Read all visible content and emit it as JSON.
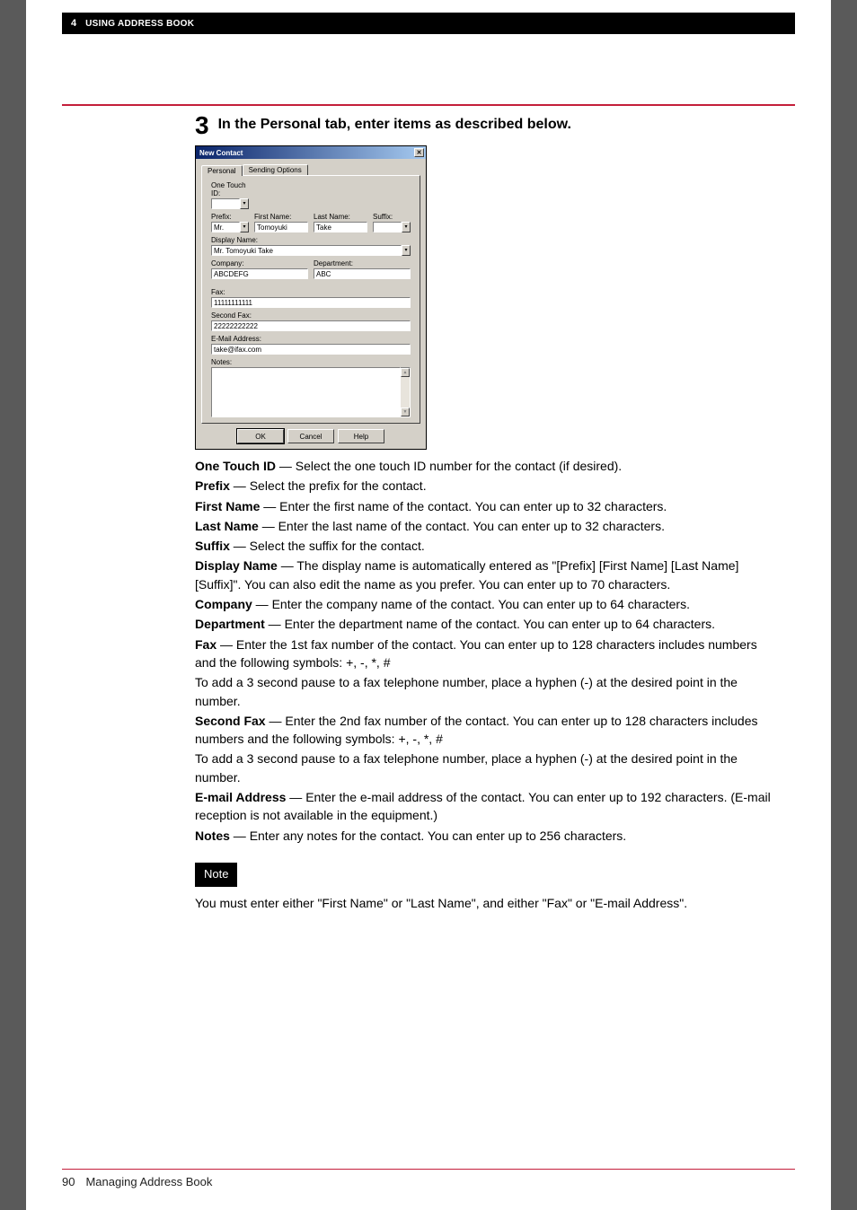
{
  "header": {
    "chapter_num": "4",
    "chapter_title": "USING ADDRESS BOOK"
  },
  "step": {
    "number": "3",
    "heading": "In the Personal tab, enter items as described below."
  },
  "dialog": {
    "title": "New Contact",
    "tabs": {
      "active": "Personal",
      "inactive": "Sending Options"
    },
    "labels": {
      "one_touch": "One Touch ID:",
      "prefix": "Prefix:",
      "first_name": "First Name:",
      "last_name": "Last Name:",
      "suffix": "Suffix:",
      "display_name": "Display Name:",
      "company": "Company:",
      "department": "Department:",
      "fax": "Fax:",
      "second_fax": "Second Fax:",
      "email": "E-Mail Address:",
      "notes": "Notes:"
    },
    "values": {
      "one_touch": "",
      "prefix": "Mr.",
      "first_name": "Tomoyuki",
      "last_name": "Take",
      "suffix": "",
      "display_name": "Mr. Tomoyuki Take",
      "company": "ABCDEFG",
      "department": "ABC",
      "fax": "11111111111",
      "second_fax": "22222222222",
      "email": "take@ifax.com",
      "notes": ""
    },
    "buttons": {
      "ok": "OK",
      "cancel": "Cancel",
      "help": "Help"
    }
  },
  "definitions": {
    "one_touch_id": {
      "term": "One Touch ID",
      "sep": " — ",
      "desc": "Select the one touch ID number for the contact (if desired)."
    },
    "prefix": {
      "term": "Prefix",
      "sep": " — ",
      "desc": "Select the prefix for the contact."
    },
    "first_name": {
      "term": "First Name",
      "sep": " — ",
      "desc": "Enter the first name of the contact. You can enter up to 32 characters."
    },
    "last_name": {
      "term": "Last Name",
      "sep": " — ",
      "desc": "Enter the last name of the contact. You can enter up to 32 characters."
    },
    "suffix": {
      "term": "Suffix",
      "sep": " — ",
      "desc": "Select the suffix for the contact."
    },
    "display_name": {
      "term": "Display Name",
      "sep": " — ",
      "desc": "The display name is automatically entered as \"[Prefix] [First Name] [Last Name] [Suffix]\". You can also edit the name as you prefer. You can enter up to 70 characters."
    },
    "company": {
      "term": "Company",
      "sep": " — ",
      "desc": "Enter the company name of the contact. You can enter up to 64 characters."
    },
    "department": {
      "term": "Department",
      "sep": " — ",
      "desc": "Enter the department name of the contact. You can enter up to 64 characters."
    },
    "fax": {
      "term": "Fax",
      "sep": " — ",
      "desc": "Enter the 1st fax number of the contact. You can enter up to 128 characters includes numbers and the following symbols: +, -, *, #"
    },
    "fax_extra": "To add a 3 second pause to a fax telephone number, place a hyphen (-) at the desired point in the number.",
    "second_fax": {
      "term": "Second Fax",
      "sep": " — ",
      "desc": "Enter the 2nd fax number of the contact. You can enter up to 128 characters includes numbers and the following symbols: +, -, *, #"
    },
    "second_fax_extra": "To add a 3 second pause to a fax telephone number, place a hyphen (-) at the desired point in the number.",
    "email": {
      "term": "E-mail Address",
      "sep": " — ",
      "desc": "Enter the e-mail address of the contact. You can enter up to 192 characters. (E-mail reception is not available in the equipment.)"
    },
    "notes": {
      "term": "Notes",
      "sep": " — ",
      "desc": "Enter any notes for the contact. You can enter up to 256 characters."
    }
  },
  "note": {
    "badge": "Note",
    "text": "You must enter either \"First Name\" or \"Last Name\", and either \"Fax\" or \"E-mail Address\"."
  },
  "footer": {
    "page": "90",
    "title": "Managing Address Book"
  }
}
